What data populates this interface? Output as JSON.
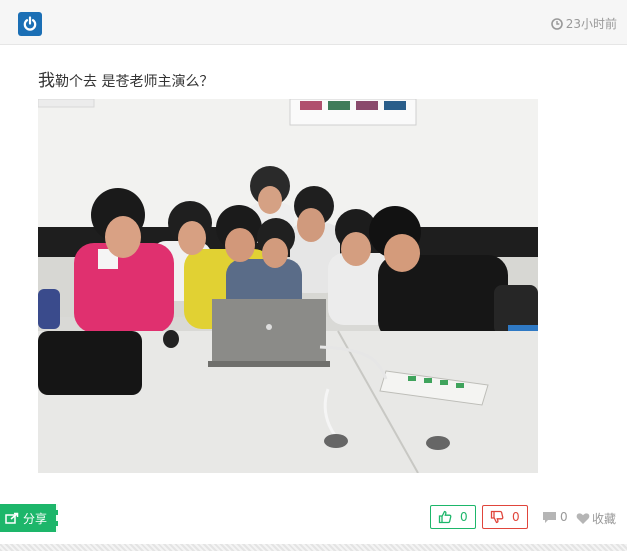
{
  "header": {
    "time_label": "23小时前",
    "logo_icon": "power-icon",
    "clock_icon": "clock-icon"
  },
  "post": {
    "title_first": "我",
    "title_rest": "勒个去 是苍老师主演么？",
    "image_icon": "photo"
  },
  "actions": {
    "share_label": "分享",
    "like_count": "0",
    "dislike_count": "0",
    "comment_count": "0",
    "favorite_label": "收藏"
  },
  "colors": {
    "brand": "#1b6fb5",
    "share": "#1db66a",
    "up": "#1db66a",
    "down": "#e0453b"
  }
}
